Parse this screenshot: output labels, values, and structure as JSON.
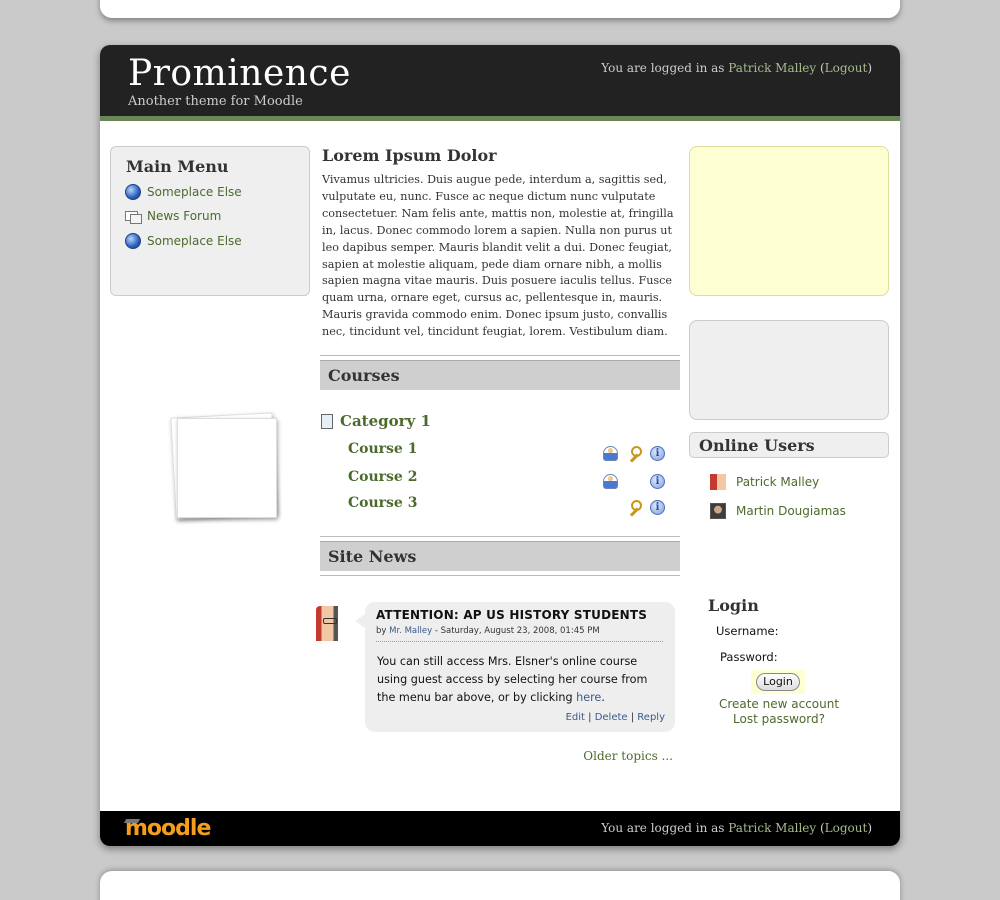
{
  "header": {
    "site_title": "Prominence",
    "site_subtitle": "Another theme for Moodle",
    "login_prefix": "You are logged in as",
    "user_name": "Patrick Malley",
    "logout": "Logout"
  },
  "main_menu": {
    "title": "Main Menu",
    "items": [
      {
        "label": "Someplace Else",
        "icon": "globe-icon"
      },
      {
        "label": "News Forum",
        "icon": "forum-icon"
      },
      {
        "label": "Someplace Else",
        "icon": "globe-icon"
      }
    ]
  },
  "intro": {
    "title": "Lorem Ipsum Dolor",
    "text": "Vivamus ultricies. Duis augue pede, interdum a, sagittis sed, vulputate eu, nunc. Fusce ac neque dictum nunc vulputate consectetuer. Nam felis ante, mattis non, molestie at, fringilla in, lacus. Donec commodo lorem a sapien. Nulla non purus ut leo dapibus semper. Mauris blandit velit a dui. Donec feugiat, sapien at molestie aliquam, pede diam ornare nibh, a mollis sapien magna vitae mauris. Duis posuere iaculis tellus. Fusce quam urna, ornare eget, cursus ac, pellentesque in, mauris. Mauris gravida commodo enim. Donec ipsum justo, convallis nec, tincidunt vel, tincidunt feugiat, lorem. Vestibulum diam."
  },
  "courses": {
    "heading": "Courses",
    "category": "Category 1",
    "items": [
      {
        "name": "Course 1",
        "guest": true,
        "key": true,
        "info": true
      },
      {
        "name": "Course 2",
        "guest": true,
        "key": false,
        "info": true
      },
      {
        "name": "Course 3",
        "guest": false,
        "key": true,
        "info": true
      }
    ]
  },
  "news": {
    "heading": "Site News",
    "post": {
      "title": "ATTENTION: AP US HISTORY STUDENTS",
      "by_prefix": "by",
      "author": "Mr. Malley",
      "date": "- Saturday, August 23, 2008, 01:45 PM",
      "body": "You can still access Mrs. Elsner's online course using guest access by selecting her course from the menu bar above, or by clicking",
      "body_link": "here",
      "edit": "Edit",
      "delete": "Delete",
      "reply": "Reply"
    },
    "older": "Older topics ..."
  },
  "online_users": {
    "title": "Online Users",
    "users": [
      "Patrick Malley",
      "Martin Dougiamas"
    ]
  },
  "login_block": {
    "title": "Login",
    "username_label": "Username:",
    "password_label": "Password:",
    "button": "Login",
    "create_account": "Create new account",
    "lost_password": "Lost password?"
  },
  "footer": {
    "logo": "moodle",
    "login_prefix": "You are logged in as",
    "user_name": "Patrick Malley",
    "logout": "Logout"
  },
  "colors": {
    "accent_green": "#4c6a2c",
    "header_bg": "#222222",
    "header_rule": "#6b8656",
    "login_link": "#a7bb8d",
    "yellow_panel": "#fdffd3"
  }
}
